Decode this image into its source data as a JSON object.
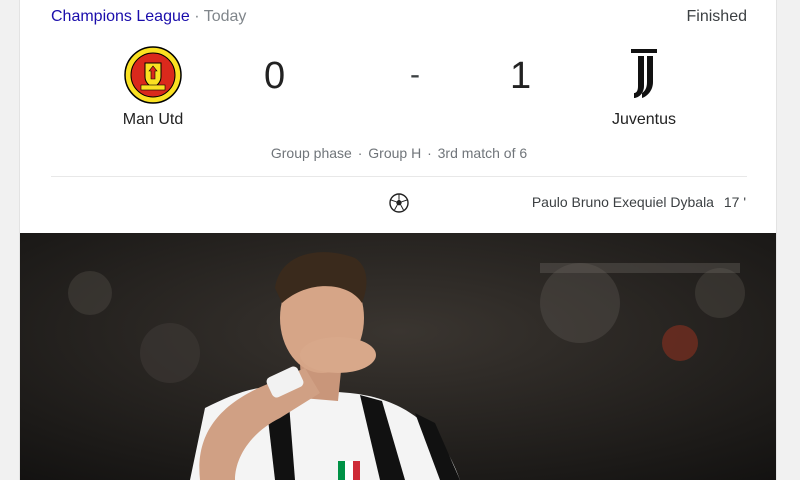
{
  "header": {
    "competition": "Champions League",
    "separator": "·",
    "date": "Today",
    "status": "Finished"
  },
  "home": {
    "name": "Man Utd",
    "score": "0"
  },
  "away": {
    "name": "Juventus",
    "score": "1"
  },
  "score_separator": "-",
  "meta": {
    "phase": "Group phase",
    "group": "Group H",
    "match": "3rd match of 6",
    "separator": "·"
  },
  "goal": {
    "scorer": "Paulo Bruno Exequiel Dybala",
    "minute": "17 '"
  },
  "icons": {
    "ball": "soccer-ball-icon",
    "home_crest": "man-utd-crest-icon",
    "away_crest": "juventus-crest-icon"
  },
  "colors": {
    "link": "#1a0dab",
    "muted": "#70757a",
    "utd_red": "#da291c",
    "utd_yellow": "#fbe122"
  }
}
